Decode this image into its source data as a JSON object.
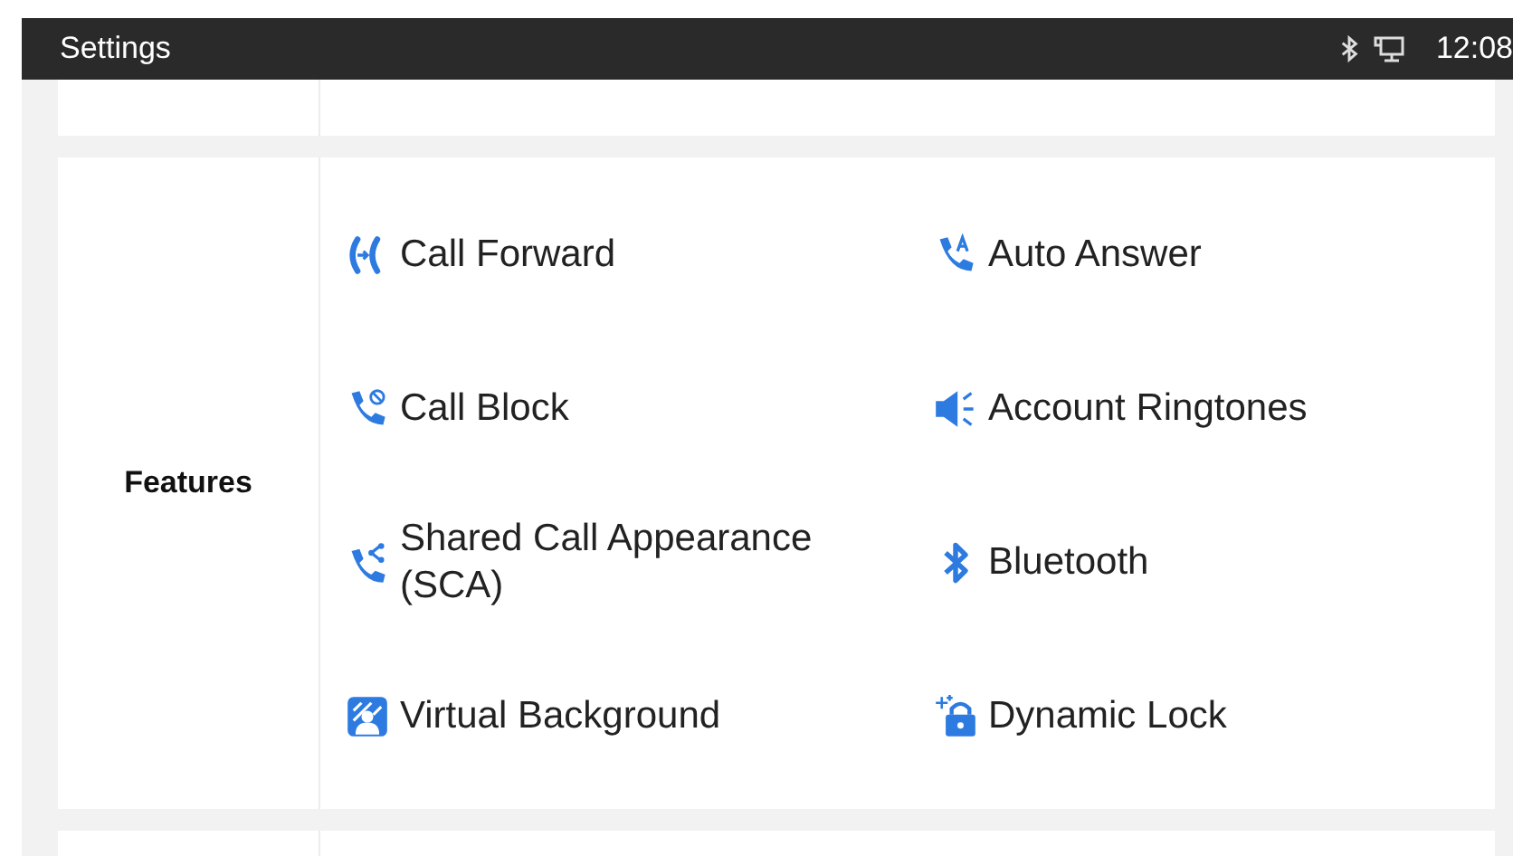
{
  "status_bar": {
    "title": "Settings",
    "time": "12:08"
  },
  "section": {
    "label": "Features",
    "items": [
      {
        "label": "Call Forward",
        "kind": "forward"
      },
      {
        "label": "Auto Answer",
        "kind": "autoanswer"
      },
      {
        "label": "Call Block",
        "kind": "block"
      },
      {
        "label": "Account Ringtones",
        "kind": "ringtone"
      },
      {
        "label": "Shared Call Appearance (SCA)",
        "kind": "shared"
      },
      {
        "label": "Bluetooth",
        "kind": "bluetooth"
      },
      {
        "label": "Virtual Background",
        "kind": "background"
      },
      {
        "label": "Dynamic Lock",
        "kind": "lock"
      }
    ]
  }
}
